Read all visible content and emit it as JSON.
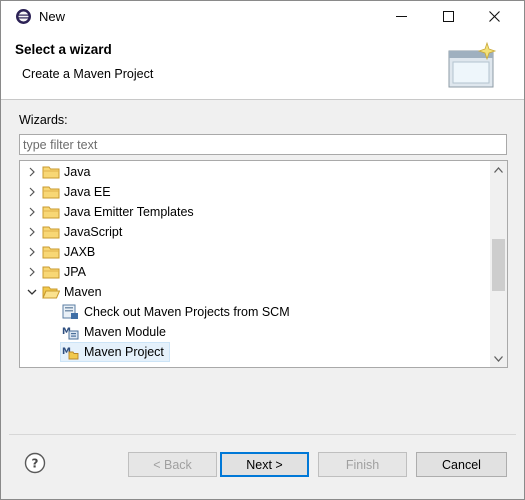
{
  "window": {
    "title": "New",
    "icon": "eclipse-icon"
  },
  "banner": {
    "title": "Select a wizard",
    "subtitle": "Create a Maven Project",
    "art_icon": "wizard-banner-icon"
  },
  "wizards": {
    "label": "Wizards:",
    "filter_placeholder": "type filter text",
    "filter_value": "",
    "items": [
      {
        "label": "Java",
        "type": "folder",
        "expanded": false,
        "level": 0
      },
      {
        "label": "Java EE",
        "type": "folder",
        "expanded": false,
        "level": 0
      },
      {
        "label": "Java Emitter Templates",
        "type": "folder",
        "expanded": false,
        "level": 0
      },
      {
        "label": "JavaScript",
        "type": "folder",
        "expanded": false,
        "level": 0
      },
      {
        "label": "JAXB",
        "type": "folder",
        "expanded": false,
        "level": 0
      },
      {
        "label": "JPA",
        "type": "folder",
        "expanded": false,
        "level": 0
      },
      {
        "label": "Maven",
        "type": "folder",
        "expanded": true,
        "level": 0
      },
      {
        "label": "Check out Maven Projects from SCM",
        "type": "maven-checkout",
        "level": 1
      },
      {
        "label": "Maven Module",
        "type": "maven-module",
        "level": 1
      },
      {
        "label": "Maven Project",
        "type": "maven-project",
        "level": 1,
        "selected": true
      }
    ]
  },
  "buttons": {
    "back": "< Back",
    "next": "Next >",
    "finish": "Finish",
    "cancel": "Cancel"
  },
  "colors": {
    "accent": "#0078d7",
    "selection": "#e5f1fb",
    "folder": "#e8b84a"
  }
}
